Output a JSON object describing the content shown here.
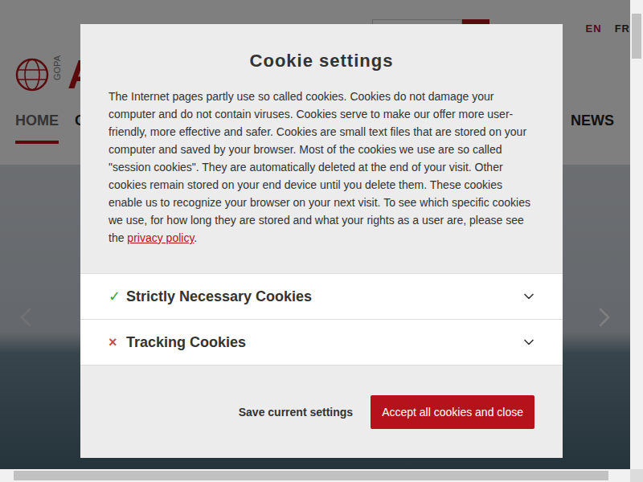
{
  "header": {
    "languages": [
      {
        "label": "EN",
        "selected": true
      },
      {
        "label": "FR",
        "selected": false
      }
    ],
    "logo": {
      "small": "GOPA",
      "big": "A"
    }
  },
  "nav": [
    {
      "label": "HOME",
      "selected": true
    },
    {
      "label": "C",
      "selected": false
    },
    {
      "label": "NEWS",
      "selected": false
    }
  ],
  "dialog": {
    "title": "Cookie settings",
    "text_before": "The Internet pages partly use so called cookies. Cookies do not damage your computer and do not contain viruses. Cookies serve to make our offer more user-friendly, more effective and safer. Cookies are small text files that are stored on your computer and saved by your browser. Most of the cookies we use are so called \"session cookies\". They are automatically deleted at the end of your visit. Other cookies remain stored on your end device until you delete them. These cookies enable us to recognize your browser on your next visit. To see which specific cookies we use, for how long they are stored and what your rights as a user are, please see the ",
    "link": "privacy policy",
    "text_after": ".",
    "sections": [
      {
        "label": "Strictly Necessary Cookies",
        "mark": "✓",
        "enabled": true,
        "expanded": false
      },
      {
        "label": "Tracking Cookies",
        "mark": "×",
        "enabled": false,
        "expanded": false
      }
    ],
    "buttons": [
      {
        "label": "Save current settings",
        "kind": "plain"
      },
      {
        "label": "Accept all cookies and close",
        "kind": "primary"
      }
    ]
  }
}
